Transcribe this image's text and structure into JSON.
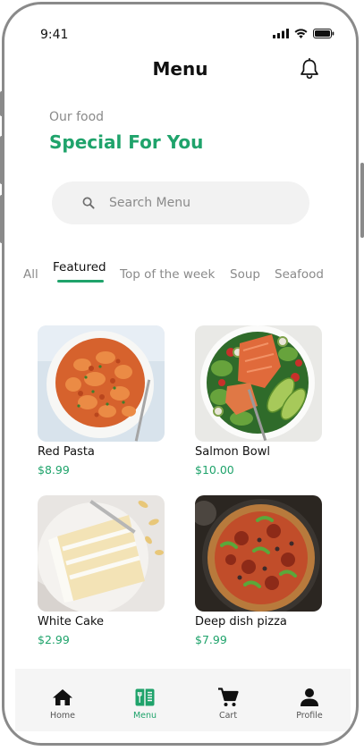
{
  "status_bar": {
    "time": "9:41"
  },
  "header": {
    "title": "Menu",
    "notification_icon": "bell-icon"
  },
  "intro": {
    "subtitle": "Our food",
    "headline": "Special For You"
  },
  "search": {
    "placeholder": "Search Menu",
    "value": "",
    "icon": "search-icon"
  },
  "categories": {
    "items": [
      "All",
      "Featured",
      "Top of the week",
      "Soup",
      "Seafood"
    ],
    "selected": "Featured"
  },
  "products": [
    {
      "name": "Red Pasta",
      "price": "$8.99"
    },
    {
      "name": "Salmon Bowl",
      "price": "$10.00"
    },
    {
      "name": "White Cake",
      "price": "$2.99"
    },
    {
      "name": "Deep dish pizza",
      "price": "$7.99"
    }
  ],
  "tab_bar": {
    "items": [
      {
        "label": "Home",
        "icon": "home-icon"
      },
      {
        "label": "Menu",
        "icon": "menu-icon"
      },
      {
        "label": "Cart",
        "icon": "cart-icon"
      },
      {
        "label": "Profile",
        "icon": "profile-icon"
      }
    ],
    "active": "Menu"
  },
  "colors": {
    "accent": "#1fa36b",
    "muted": "#8a8a8a",
    "text": "#111111",
    "surface": "#f2f2f2"
  }
}
